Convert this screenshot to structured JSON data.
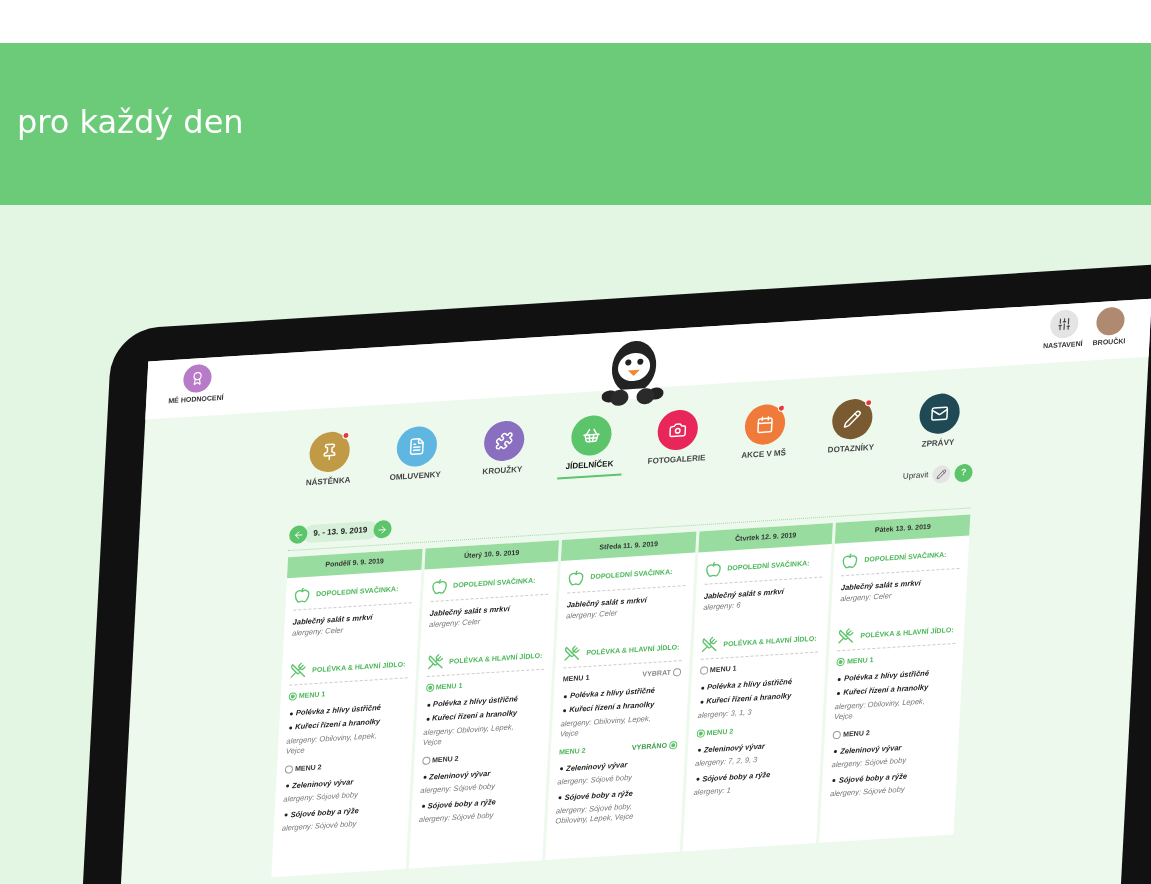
{
  "banner": {
    "title": "pro každý den"
  },
  "app": {
    "profile_label": "MÉ HODNOCENÍ",
    "settings_label": "NASTAVENÍ",
    "user_label": "BROUČKI",
    "nav": [
      {
        "label": "NÁSTĚNKA",
        "color": "#c09a45",
        "badge": true,
        "selected": false
      },
      {
        "label": "OMLUVENKY",
        "color": "#5fb6e0",
        "badge": false,
        "selected": false
      },
      {
        "label": "KROUŽKY",
        "color": "#8a6fc0",
        "badge": false,
        "selected": false
      },
      {
        "label": "JÍDELNÍČEK",
        "color": "#5cc46a",
        "badge": false,
        "selected": true
      },
      {
        "label": "FOTOGALERIE",
        "color": "#e8265a",
        "badge": false,
        "selected": false
      },
      {
        "label": "AKCE V MŠ",
        "color": "#f07a3a",
        "badge": true,
        "selected": false
      },
      {
        "label": "DOTAZNÍKY",
        "color": "#7a5a30",
        "badge": true,
        "selected": false
      },
      {
        "label": "ZPRÁVY",
        "color": "#1f4a55",
        "badge": false,
        "selected": false
      }
    ],
    "week": "9. - 13. 9. 2019",
    "edit_label": "Upravit",
    "help": "?",
    "days": [
      {
        "title": "Pondělí 9. 9. 2019",
        "snack_heading": "DOPOLEDNÍ SVAČINKA:",
        "snack": "Jablečný salát s mrkví",
        "snack_allergens": "alergeny: Celer",
        "lunch_heading": "POLÉVKA & HLAVNÍ JÍDLO:",
        "menus": [
          {
            "label": "MENU 1",
            "kind": "inline",
            "selected": true,
            "items": [
              {
                "kind": "dish",
                "text": "Polévka z hlívy ústřičné"
              },
              {
                "kind": "dish",
                "text": "Kuřecí řízení a hranolky"
              },
              {
                "kind": "allergens",
                "text": "alergeny: Obiloviny, Lepek, Vejce"
              }
            ]
          },
          {
            "label": "MENU 2",
            "kind": "inline",
            "selected": false,
            "items": [
              {
                "kind": "dish",
                "text": "Zeleninový vývar"
              },
              {
                "kind": "allergens",
                "text": "alergeny: Sójové boby"
              },
              {
                "kind": "dish",
                "text": "Sójové boby a rýže"
              },
              {
                "kind": "allergens",
                "text": "alergeny: Sójové boby"
              }
            ]
          }
        ]
      },
      {
        "title": "Úterý 10. 9. 2019",
        "snack_heading": "DOPOLEDNÍ SVAČINKA:",
        "snack": "Jablečný salát s mrkví",
        "snack_allergens": "alergeny: Celer",
        "lunch_heading": "POLÉVKA & HLAVNÍ JÍDLO:",
        "menus": [
          {
            "label": "MENU 1",
            "kind": "inline",
            "selected": true,
            "items": [
              {
                "kind": "dish",
                "text": "Polévka z hlívy ústřičné"
              },
              {
                "kind": "dish",
                "text": "Kuřecí řízení a hranolky"
              },
              {
                "kind": "allergens",
                "text": "alergeny: Obiloviny, Lepek, Vejce"
              }
            ]
          },
          {
            "label": "MENU 2",
            "kind": "inline",
            "selected": false,
            "items": [
              {
                "kind": "dish",
                "text": "Zeleninový vývar"
              },
              {
                "kind": "allergens",
                "text": "alergeny: Sójové boby"
              },
              {
                "kind": "dish",
                "text": "Sójové boby a rýže"
              },
              {
                "kind": "allergens",
                "text": "alergeny: Sójové boby"
              }
            ]
          }
        ]
      },
      {
        "title": "Středa 11. 9. 2019",
        "snack_heading": "DOPOLEDNÍ SVAČINKA:",
        "snack": "Jablečný salát s mrkví",
        "snack_allergens": "alergeny: Celer",
        "lunch_heading": "POLÉVKA & HLAVNÍ JÍDLO:",
        "menus": [
          {
            "label": "MENU 1",
            "kind": "action",
            "action": "VYBRAT",
            "selected": false,
            "items": [
              {
                "kind": "dish",
                "text": "Polévka z hlívy ústřičné"
              },
              {
                "kind": "dish",
                "text": "Kuřecí řízení a hranolky"
              },
              {
                "kind": "allergens",
                "text": "alergeny: Obiloviny, Lepek, Vejce"
              }
            ]
          },
          {
            "label": "MENU 2",
            "kind": "action",
            "action": "VYBRÁNO",
            "selected": true,
            "items": [
              {
                "kind": "dish",
                "text": "Zeleninový vývar"
              },
              {
                "kind": "allergens",
                "text": "alergeny: Sójové boby"
              },
              {
                "kind": "dish",
                "text": "Sójové boby a rýže"
              },
              {
                "kind": "allergens",
                "text": "alergeny: Sójové boby, Obiloviny, Lepek, Vejce"
              }
            ]
          }
        ]
      },
      {
        "title": "Čtvrtek 12. 9. 2019",
        "snack_heading": "DOPOLEDNÍ SVAČINKA:",
        "snack": "Jablečný salát s mrkví",
        "snack_allergens": "alergeny: 6",
        "lunch_heading": "POLÉVKA & HLAVNÍ JÍDLO:",
        "menus": [
          {
            "label": "MENU 1",
            "kind": "inline",
            "selected": false,
            "items": [
              {
                "kind": "dish",
                "text": "Polévka z hlívy ústřičné"
              },
              {
                "kind": "dish",
                "text": "Kuřecí řízení a hranolky"
              },
              {
                "kind": "allergens",
                "text": "alergeny: 3, 1, 3"
              }
            ]
          },
          {
            "label": "MENU 2",
            "kind": "inline",
            "selected": true,
            "items": [
              {
                "kind": "dish",
                "text": "Zeleninový vývar"
              },
              {
                "kind": "allergens",
                "text": "alergeny: 7, 2, 9, 3"
              },
              {
                "kind": "dish",
                "text": "Sójové boby a rýže"
              },
              {
                "kind": "allergens",
                "text": "alergeny: 1"
              }
            ]
          }
        ]
      },
      {
        "title": "Pátek 13. 9. 2019",
        "snack_heading": "DOPOLEDNÍ SVAČINKA:",
        "snack": "Jablečný salát s mrkví",
        "snack_allergens": "alergeny: Celer",
        "lunch_heading": "POLÉVKA & HLAVNÍ JÍDLO:",
        "menus": [
          {
            "label": "MENU 1",
            "kind": "inline",
            "selected": true,
            "items": [
              {
                "kind": "dish",
                "text": "Polévka z hlívy ústřičné"
              },
              {
                "kind": "dish",
                "text": "Kuřecí řízení a hranolky"
              },
              {
                "kind": "allergens",
                "text": "alergeny: Obiloviny, Lepek, Vejce"
              }
            ]
          },
          {
            "label": "MENU 2",
            "kind": "inline",
            "selected": false,
            "items": [
              {
                "kind": "dish",
                "text": "Zeleninový vývar"
              },
              {
                "kind": "allergens",
                "text": "alergeny: Sójové boby"
              },
              {
                "kind": "dish",
                "text": "Sójové boby a rýže"
              },
              {
                "kind": "allergens",
                "text": "alergeny: Sójové boby"
              }
            ]
          }
        ]
      }
    ]
  }
}
